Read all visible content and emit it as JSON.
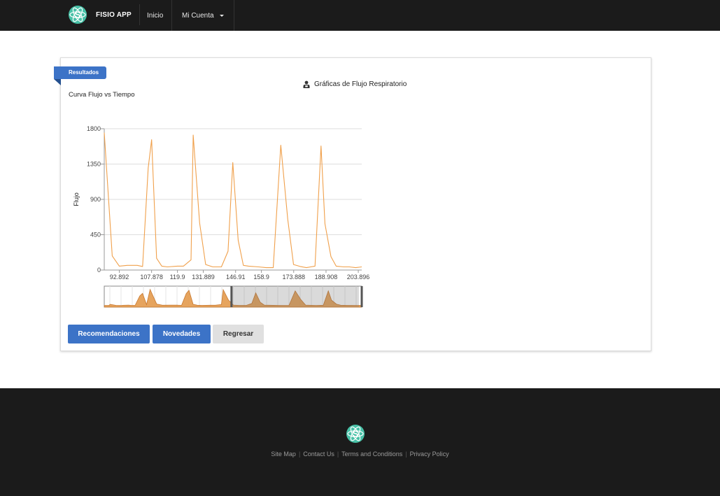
{
  "navbar": {
    "brand_name": "FISIO APP",
    "links": {
      "inicio": "Inicio",
      "mi_cuenta": "Mi Cuenta"
    }
  },
  "card": {
    "ribbon_label": "Resultados",
    "header_title": "Gráficas de Flujo Respiratorio",
    "header_icon": "user-icon"
  },
  "buttons": {
    "recomendaciones": "Recomendaciones",
    "novedades": "Novedades",
    "regresar": "Regresar"
  },
  "footer": {
    "links": [
      "Site Map",
      "Contact Us",
      "Terms and Conditions",
      "Privacy Policy"
    ]
  },
  "colors": {
    "accent": "#3c73c7",
    "series": "#f0a04b",
    "navbar_bg": "#1b1b1b",
    "logo": "#48c1a7"
  },
  "chart_data": {
    "type": "line",
    "title": "Curva Flujo vs Tiempo",
    "xlabel": "",
    "ylabel": "Flujo",
    "ylim": [
      0,
      1800
    ],
    "yticks": [
      0,
      450,
      900,
      1350,
      1800
    ],
    "xlim": [
      85.9,
      205.5
    ],
    "xticks": [
      "92.892",
      "107.878",
      "119.9",
      "131.889",
      "146.91",
      "158.9",
      "173.888",
      "188.908",
      "203.896"
    ],
    "grid": true,
    "series": [
      {
        "x": [
          85.9,
          89.6,
          92.9,
          96.6,
          101.2,
          103.7,
          106.3,
          107.9,
          110.2,
          112.6,
          115.2,
          119.9,
          122.7,
          126.2,
          127.2,
          130.2,
          133.0,
          136.3,
          140.3,
          143.4,
          145.6,
          148.1,
          150.5,
          152.9,
          157.6,
          161.1,
          164.4,
          167.9,
          171.1,
          173.8,
          176.9,
          179.8,
          183.8,
          186.6,
          188.4,
          191.2,
          193.6,
          197.1,
          199.7,
          202.7,
          205.5
        ],
        "y": [
          1750,
          180,
          50,
          60,
          60,
          45,
          1300,
          1660,
          150,
          50,
          40,
          50,
          50,
          130,
          1720,
          600,
          70,
          40,
          40,
          240,
          1370,
          380,
          60,
          50,
          40,
          30,
          30,
          1590,
          650,
          70,
          45,
          30,
          50,
          1580,
          590,
          170,
          50,
          40,
          40,
          30,
          40
        ]
      }
    ],
    "navigator": {
      "xlim": [
        60,
        205.5
      ],
      "selected_range": [
        131.889,
        203.896
      ]
    }
  }
}
